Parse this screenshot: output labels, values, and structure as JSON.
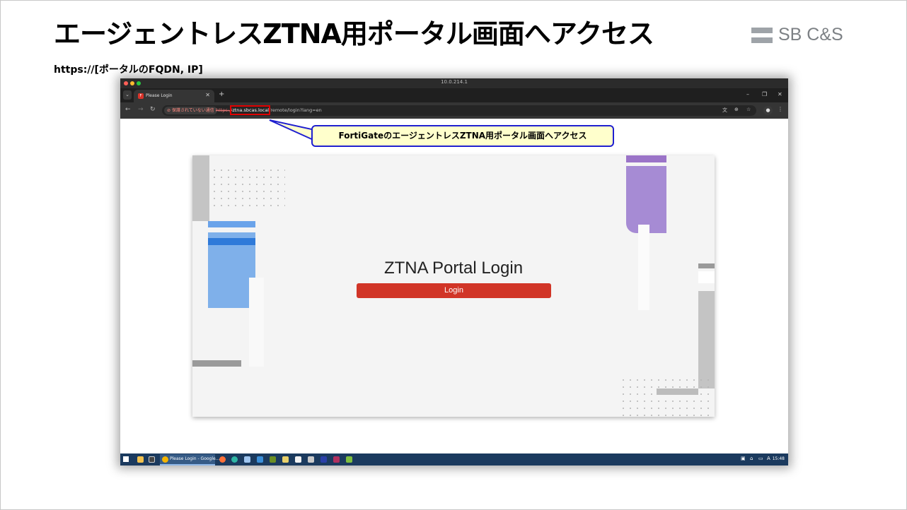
{
  "slide": {
    "title": "エージェントレスZTNA用ポータル画面へアクセス",
    "subtitle": "https://[ポータルのFQDN, IP]",
    "logo_text": "SB C&S",
    "logo_color": "#9ea3a8"
  },
  "browser": {
    "window_title": "10.0.214.1",
    "tab_title": "Please Login",
    "tab_favicon": "fortinet-icon",
    "security_chip": "保護されていない通信",
    "url_scheme": "https://",
    "url_host": "ztna.sbcas.local/",
    "url_path": "remote/login?lang=en",
    "nav_icons": [
      "back-icon",
      "forward-icon",
      "reload-icon"
    ],
    "omnibox_icons": [
      "translate-icon",
      "zoom-icon",
      "star-icon"
    ]
  },
  "callout": {
    "text": "FortiGateのエージェントレスZTNA用ポータル画面へアクセス",
    "border_color": "#1f1fd0",
    "fill_color": "#ffffcc"
  },
  "portal": {
    "title": "ZTNA Portal Login",
    "login_button": "Login",
    "button_color": "#d13527"
  },
  "taskbar": {
    "active_app_label": "Please Login - Google...",
    "clock": "15:48",
    "ime_indicator": "A"
  },
  "colors": {
    "highlight_box": "#e00000",
    "accent_blue": "#7fb0ea",
    "accent_purple": "#a68bd4"
  }
}
